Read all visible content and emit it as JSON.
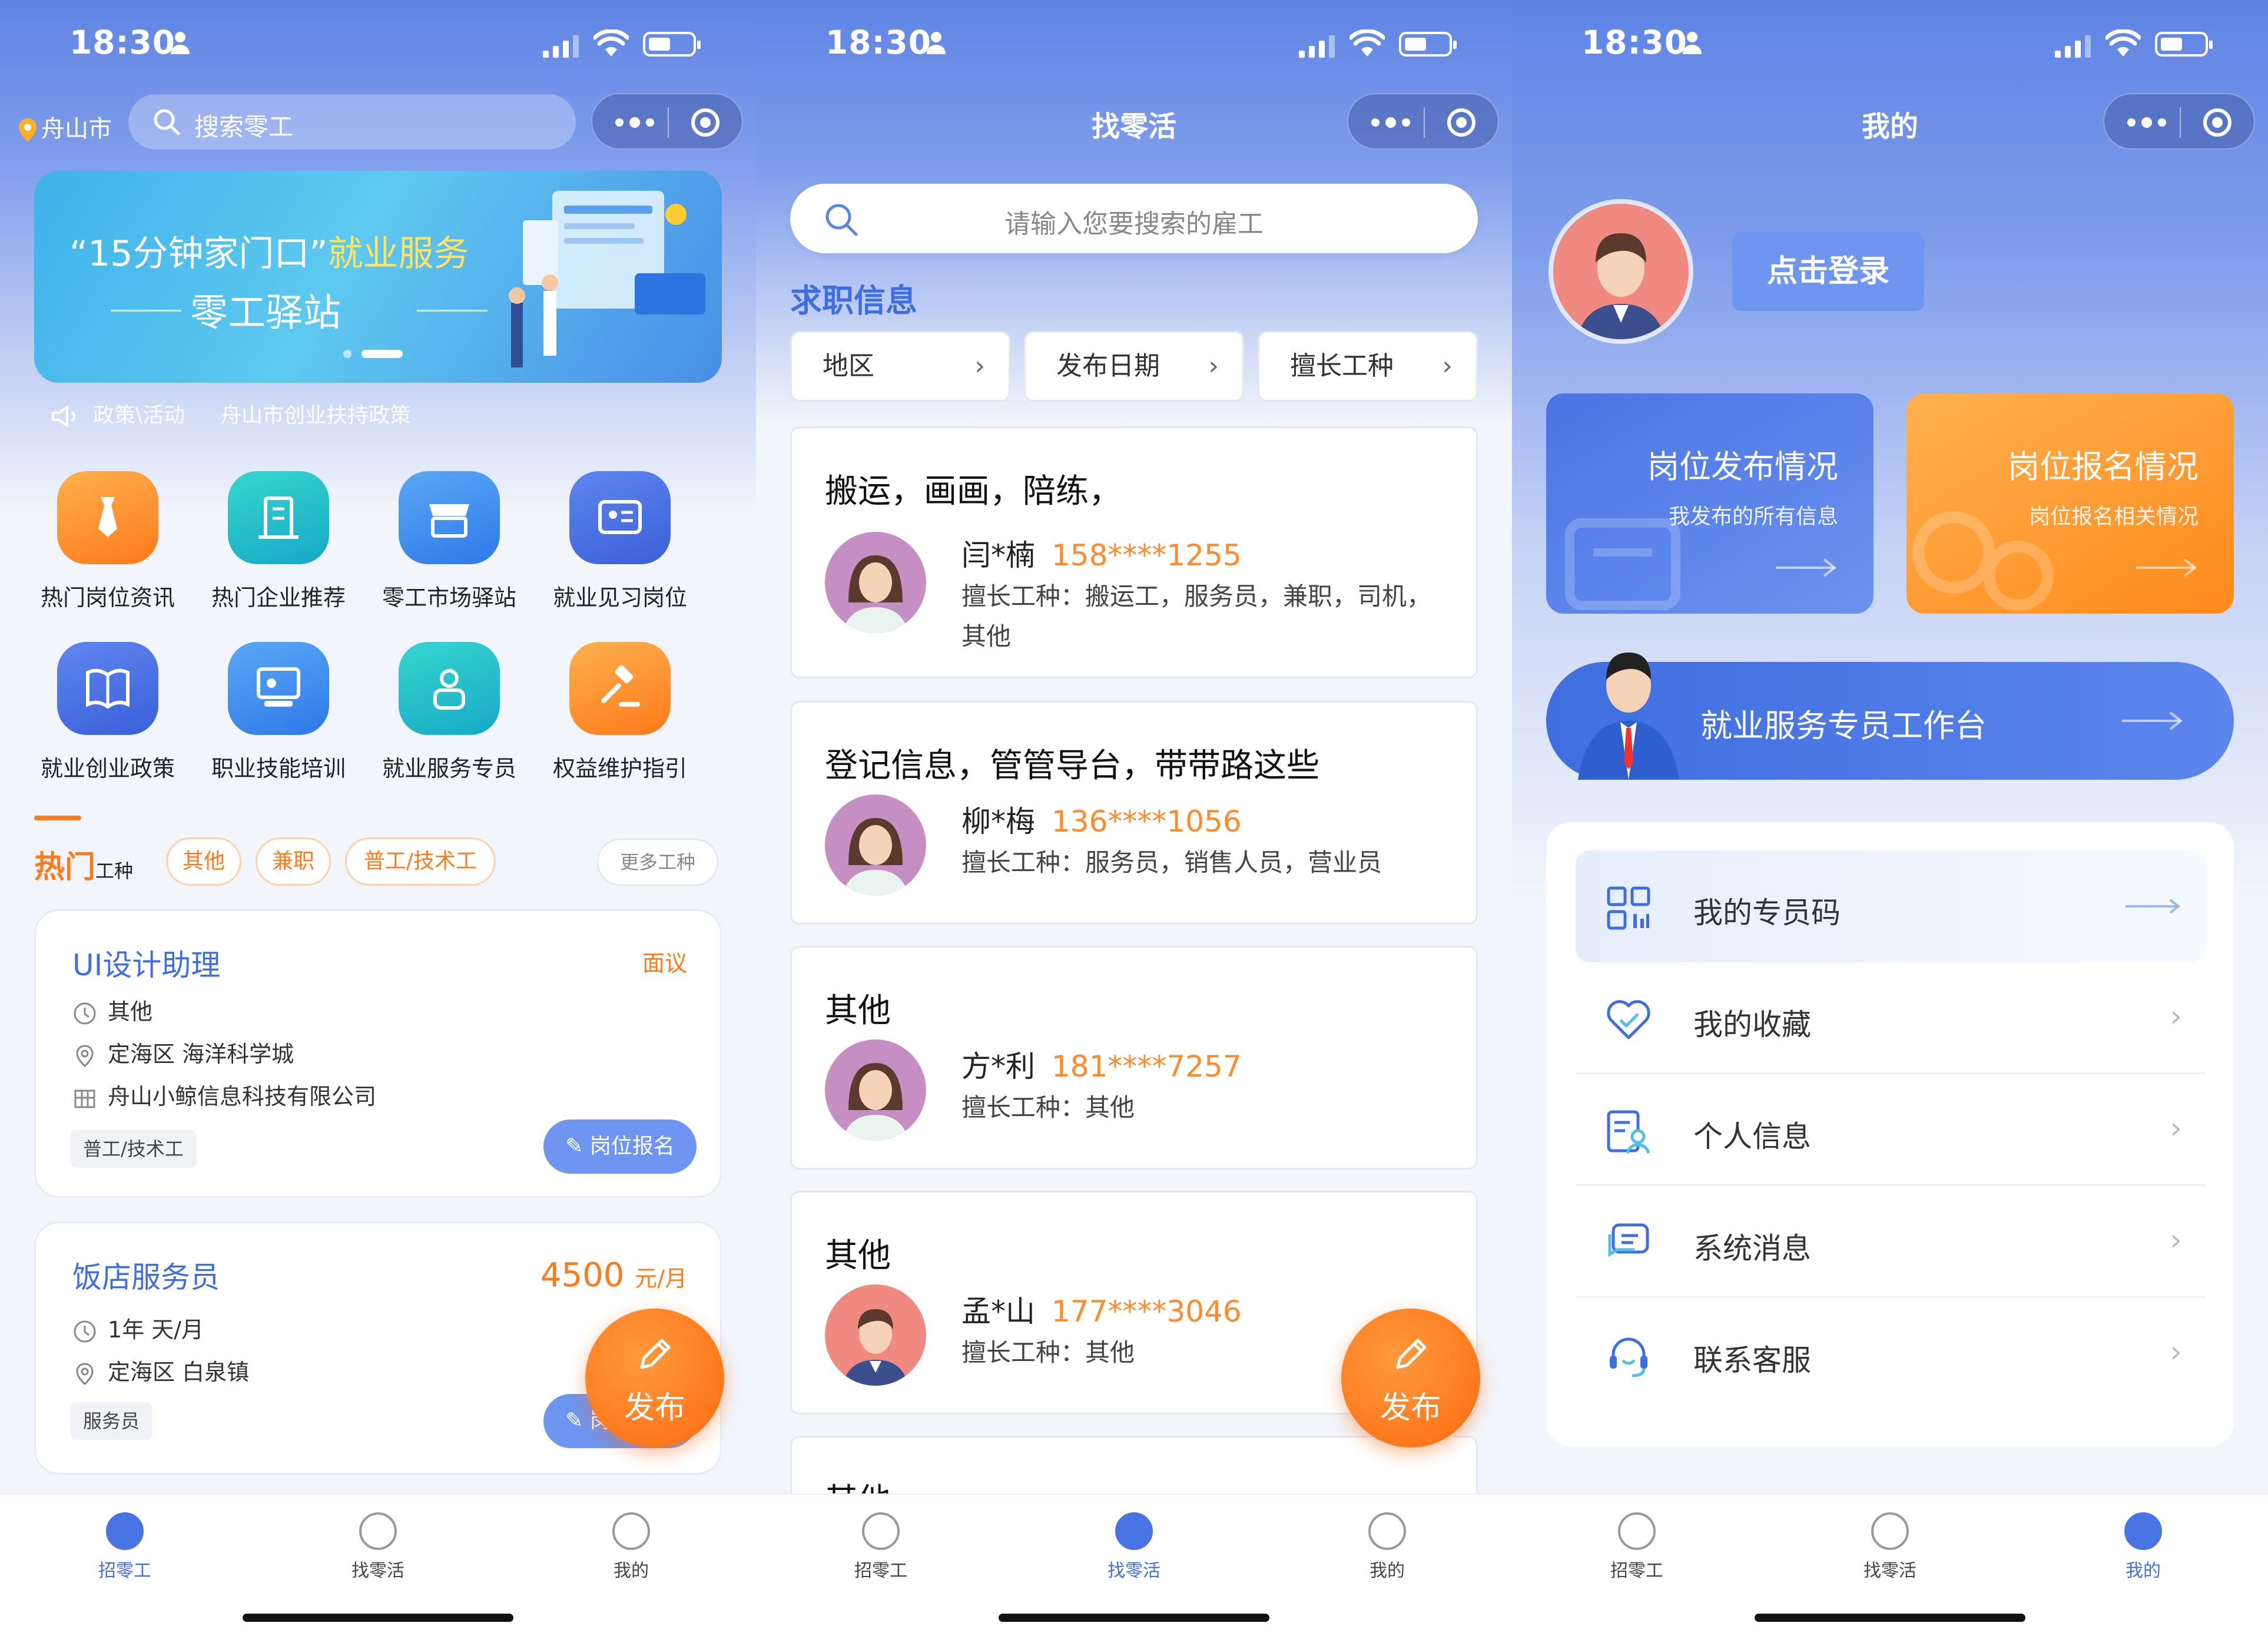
{
  "status": {
    "time": "18:30"
  },
  "tabbar": {
    "tab1": "招零工",
    "tab2": "找零活",
    "tab3": "我的"
  },
  "screen1": {
    "location": "舟山市",
    "search_placeholder": "搜索零工",
    "banner": {
      "quote_part1": "“15分钟家门口”",
      "quote_part2": "就业服务",
      "subtitle": "零工驿站"
    },
    "notice": {
      "label": "政策\\活动",
      "text": "舟山市创业扶持政策"
    },
    "grid": [
      {
        "label": "热门岗位资讯",
        "icon": "tie-icon",
        "color": "orange"
      },
      {
        "label": "热门企业推荐",
        "icon": "building-icon",
        "color": "teal"
      },
      {
        "label": "零工市场驿站",
        "icon": "store-icon",
        "color": "blue"
      },
      {
        "label": "就业见习岗位",
        "icon": "id-card-icon",
        "color": "indigo"
      },
      {
        "label": "就业创业政策",
        "icon": "book-icon",
        "color": "indigo"
      },
      {
        "label": "职业技能培训",
        "icon": "training-icon",
        "color": "blue"
      },
      {
        "label": "就业服务专员",
        "icon": "person-icon",
        "color": "teal"
      },
      {
        "label": "权益维护指引",
        "icon": "gavel-icon",
        "color": "orange"
      }
    ],
    "hot_title": "热门",
    "hot_suffix": "工种",
    "chips": [
      "其他",
      "兼职",
      "普工/技术工"
    ],
    "more_chip": "更多工种",
    "jobs": [
      {
        "title": "UI设计助理",
        "salary": "面议",
        "period": "其他",
        "location": "定海区 海洋科学城",
        "company": "舟山小鲸信息科技有限公司",
        "tag": "普工/技术工",
        "apply": "岗位报名"
      },
      {
        "title": "饭店服务员",
        "salary_value": "4500",
        "salary_unit": "元/月",
        "period": "1年 天/月",
        "location": "定海区 白泉镇",
        "tag": "服务员",
        "apply": "岗位报名"
      }
    ],
    "fab": "发布"
  },
  "screen2": {
    "title": "找零活",
    "search_placeholder": "请输入您要搜索的雇工",
    "section": "求职信息",
    "filters": [
      "地区",
      "发布日期",
      "擅长工种"
    ],
    "workers": [
      {
        "title": "搬运，画画，陪练，",
        "name": "闫*楠",
        "phone": "158****1255",
        "skills": "擅长工种：搬运工，服务员，兼职，司机，其他",
        "avatar": "female"
      },
      {
        "title": "登记信息，管管导台，带带路这些",
        "name": "柳*梅",
        "phone": "136****1056",
        "skills": "擅长工种：服务员，销售人员，营业员",
        "avatar": "female"
      },
      {
        "title": "其他",
        "name": "方*利",
        "phone": "181****7257",
        "skills": "擅长工种：其他",
        "avatar": "female"
      },
      {
        "title": "其他",
        "name": "孟*山",
        "phone": "177****3046",
        "skills": "擅长工种：其他",
        "avatar": "male"
      },
      {
        "title": "其他"
      }
    ],
    "fab": "发布"
  },
  "screen3": {
    "title": "我的",
    "login": "点击登录",
    "stats": [
      {
        "title": "岗位发布情况",
        "sub": "我发布的所有信息",
        "color": "#5b84e8"
      },
      {
        "title": "岗位报名情况",
        "sub": "岗位报名相关情况",
        "color": "#ff9a30"
      }
    ],
    "workbench": "就业服务专员工作台",
    "menu": [
      {
        "label": "我的专员码",
        "icon": "qrcode-icon"
      },
      {
        "label": "我的收藏",
        "icon": "heart-icon"
      },
      {
        "label": "个人信息",
        "icon": "profile-icon"
      },
      {
        "label": "系统消息",
        "icon": "message-icon"
      },
      {
        "label": "联系客服",
        "icon": "headset-icon"
      }
    ]
  }
}
